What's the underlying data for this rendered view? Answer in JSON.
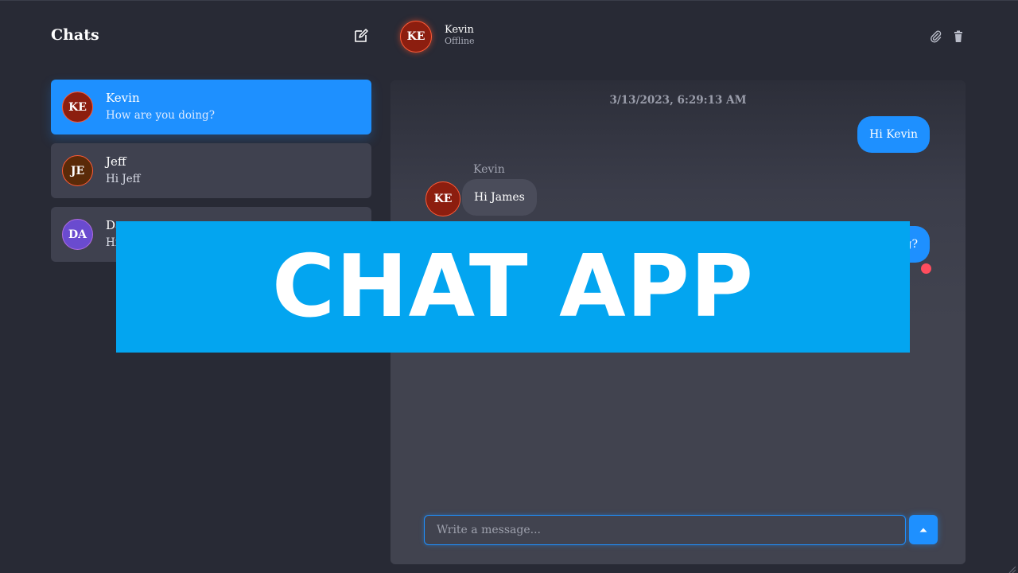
{
  "sidebar": {
    "title": "Chats",
    "new_chat_icon": "edit-icon",
    "chats": [
      {
        "initials": "KE",
        "name": "Kevin",
        "preview": "How are you doing?",
        "avatar_color": "#8c1e0f",
        "active": true
      },
      {
        "initials": "JE",
        "name": "Jeff",
        "preview": "Hi Jeff",
        "avatar_color": "#5a2a08",
        "active": false
      },
      {
        "initials": "DA",
        "name": "Da",
        "preview": "Hi",
        "avatar_color": "#6a4bcf",
        "active": false
      }
    ]
  },
  "conversation": {
    "contact_initials": "KE",
    "contact_name": "Kevin",
    "contact_status": "Offline",
    "attach_icon": "paperclip-icon",
    "delete_icon": "trash-icon",
    "timestamp": "3/13/2023, 6:29:13 AM",
    "messages": [
      {
        "direction": "out",
        "text": "Hi Kevin"
      },
      {
        "direction": "in",
        "sender": "Kevin",
        "initials": "KE",
        "text": "Hi James"
      },
      {
        "direction": "out",
        "text": "g?"
      }
    ],
    "input_placeholder": "Write a message...",
    "send_icon": "triangle-up-icon"
  },
  "banner": {
    "text": "CHAT APP"
  },
  "colors": {
    "background": "#282a35",
    "panel": "#41434f",
    "accent": "#1e90ff",
    "banner": "#03a5f0",
    "unread": "#ff4d5e"
  }
}
